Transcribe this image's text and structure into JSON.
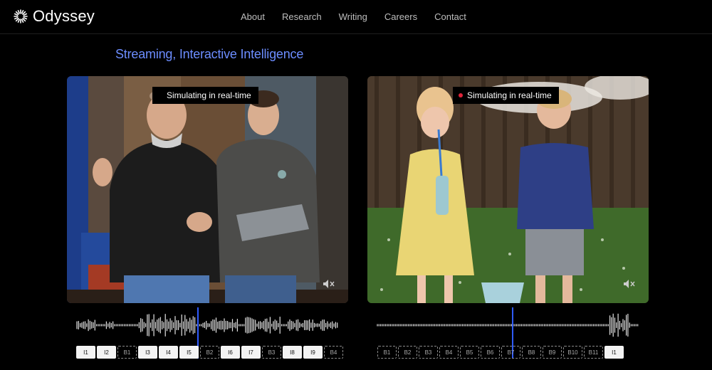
{
  "brand": {
    "name": "Odyssey",
    "logo_icon": "sunburst-icon"
  },
  "nav": {
    "items": [
      "About",
      "Research",
      "Writing",
      "Careers",
      "Contact"
    ]
  },
  "headline": "Streaming, Interactive Intelligence",
  "videos": [
    {
      "badge": "Simulating in real-time",
      "muted": true
    },
    {
      "badge": "Simulating in real-time",
      "muted": true
    }
  ],
  "timelines": [
    {
      "tokens": [
        "I1",
        "I2",
        "B1",
        "I3",
        "I4",
        "I5",
        "B2",
        "I6",
        "I7",
        "B3",
        "I8",
        "I9",
        "B4"
      ]
    },
    {
      "tokens": [
        "B1",
        "B2",
        "B3",
        "B4",
        "B5",
        "B6",
        "B7",
        "B8",
        "B9",
        "B10",
        "B11",
        "I1"
      ]
    }
  ],
  "colors": {
    "accent": "#6c8dff",
    "playhead": "#2f5bff",
    "record": "#e0243a"
  }
}
